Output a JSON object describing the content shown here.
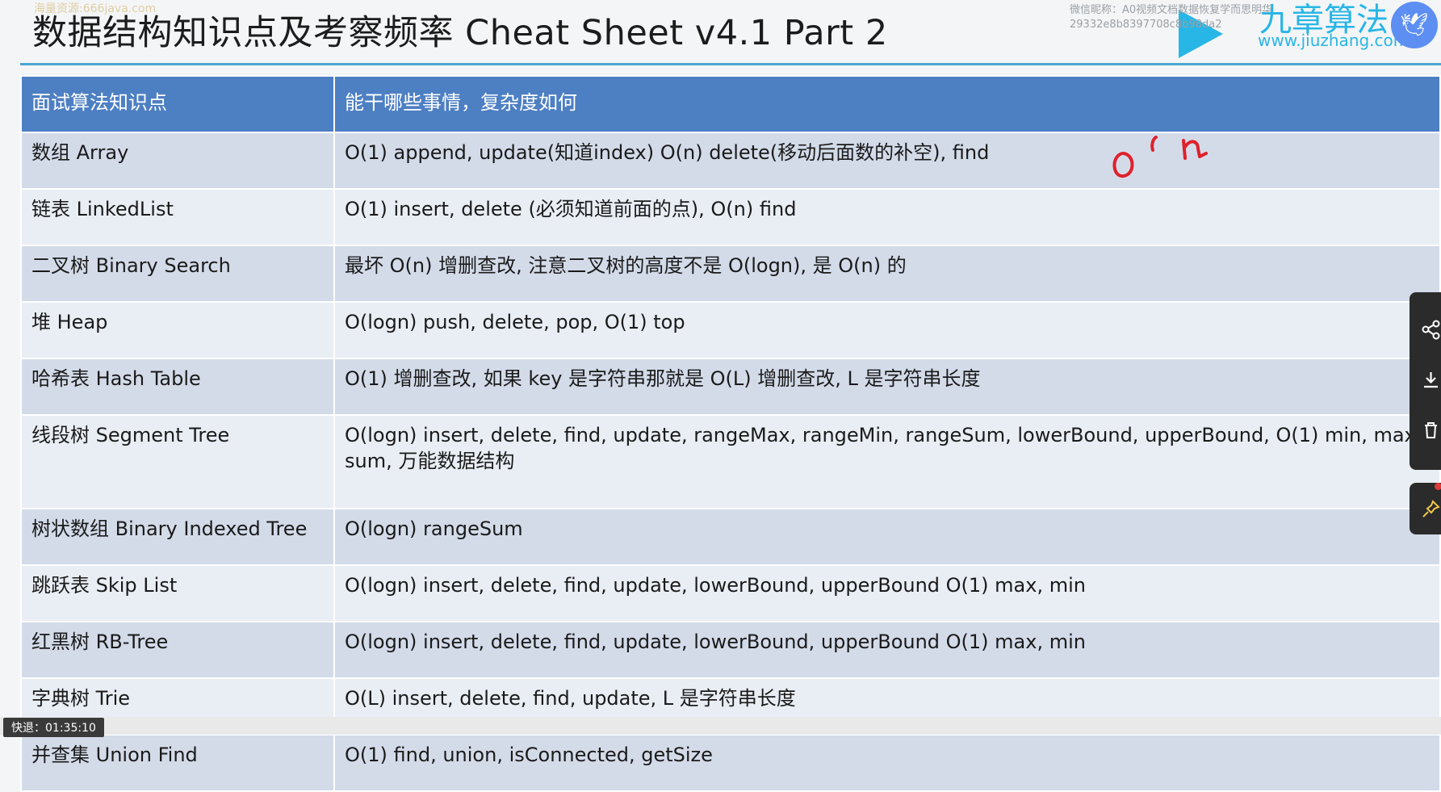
{
  "slide": {
    "title": "数据结构知识点及考察频率 Cheat Sheet v4.1 Part 2",
    "source_tag": "海量资源:666java.com"
  },
  "logo": {
    "brand": "九章算法",
    "url": "www.jiuzhang.com"
  },
  "watermark": {
    "line1": "微信昵称：A0视频文档数据恢复学而思明华",
    "line2": "29332e8b8397708c8b98da2"
  },
  "table": {
    "headers": [
      "面试算法知识点",
      "能干哪些事情，复杂度如何"
    ],
    "rows": [
      {
        "name": "数组 Array",
        "desc": "O(1) append, update(知道index) O(n) delete(移动后面数的补空), find"
      },
      {
        "name": "链表 LinkedList",
        "desc": "O(1) insert, delete (必须知道前面的点), O(n) find"
      },
      {
        "name": "二叉树 Binary Search",
        "desc": "最坏 O(n) 增删查改, 注意二叉树的高度不是 O(logn), 是 O(n) 的"
      },
      {
        "name": "堆 Heap",
        "desc": "O(logn) push, delete, pop, O(1) top"
      },
      {
        "name": "哈希表 Hash Table",
        "desc": "O(1) 增删查改, 如果 key 是字符串那就是 O(L) 增删查改, L 是字符串长度"
      },
      {
        "name": "线段树 Segment Tree",
        "desc": "O(logn) insert, delete, find, update, rangeMax, rangeMin, rangeSum, lowerBound, upperBound, O(1) min, max, sum, 万能数据结构"
      },
      {
        "name": "树状数组 Binary Indexed Tree",
        "desc": "O(logn) rangeSum"
      },
      {
        "name": "跳跃表 Skip List",
        "desc": "O(logn) insert, delete, find, update, lowerBound, upperBound O(1) max, min"
      },
      {
        "name": "红黑树 RB-Tree",
        "desc": "O(logn) insert, delete, find, update, lowerBound, upperBound O(1) max, min"
      },
      {
        "name": "字典树 Trie",
        "desc": "O(L) insert, delete, find, update, L 是字符串长度"
      },
      {
        "name": "并查集 Union Find",
        "desc": "O(1) find, union, isConnected, getSize"
      }
    ]
  },
  "side_tools": {
    "icons": [
      "share-icon",
      "download-icon",
      "trash-icon",
      "pin-icon"
    ]
  },
  "player": {
    "timestamp": "快退：01:35:10"
  },
  "colors": {
    "header_bg": "#4d7fc3",
    "row_odd": "#d3dbe9",
    "row_even": "#e9edf4",
    "accent": "#28b6e6",
    "annotation": "#e0202a"
  }
}
